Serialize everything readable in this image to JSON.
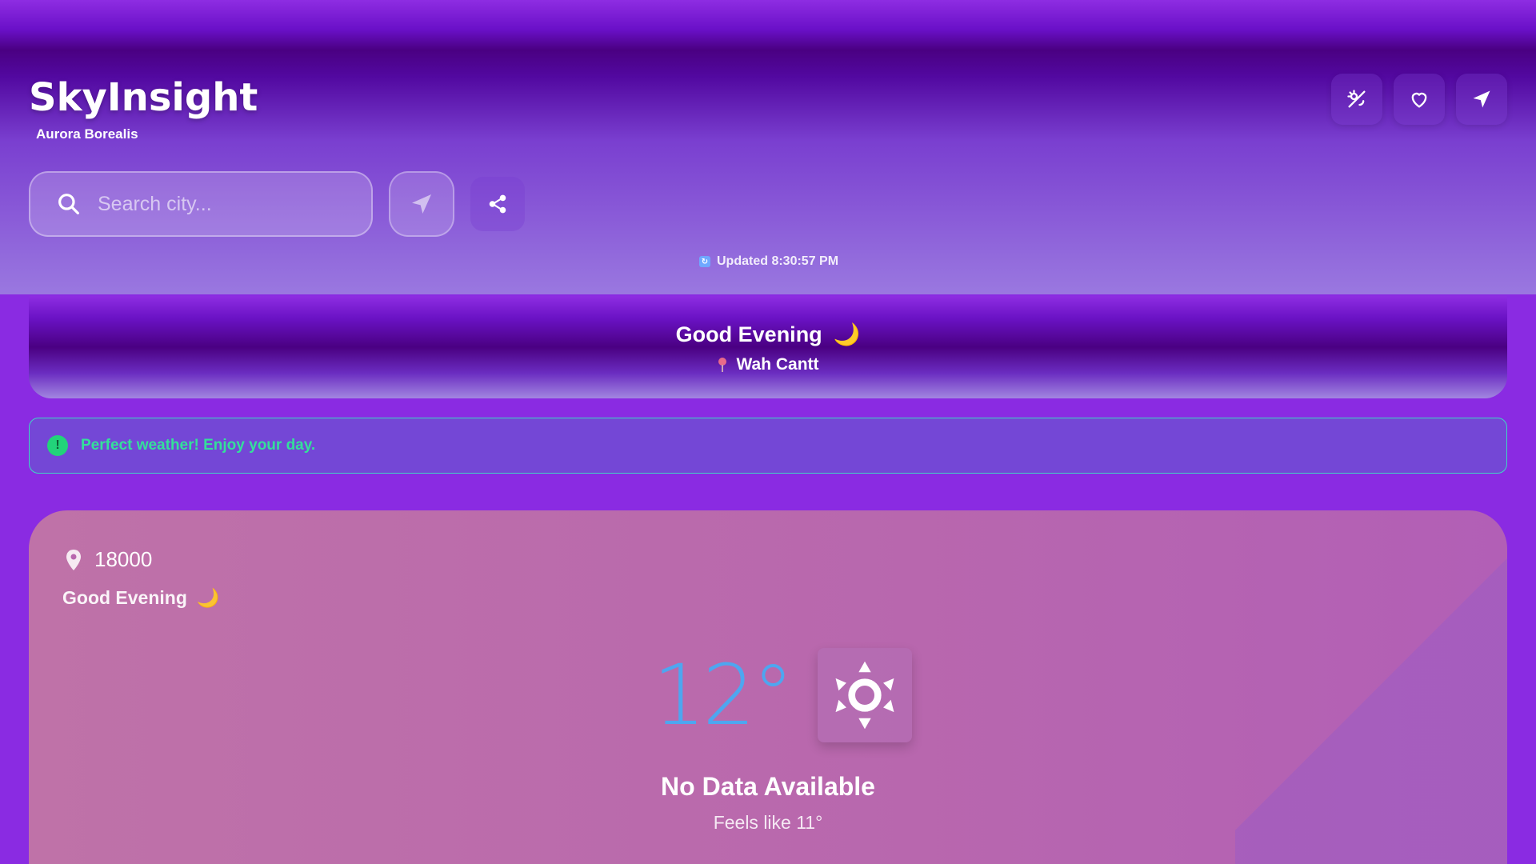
{
  "app": {
    "title": "SkyInsight",
    "subtitle": "Aurora Borealis"
  },
  "header_actions": [
    {
      "name": "theme-toggle",
      "icon": "sun-moon-icon"
    },
    {
      "name": "favorites",
      "icon": "heart-icon"
    },
    {
      "name": "navigate",
      "icon": "navigation-arrow-icon"
    }
  ],
  "search": {
    "placeholder": "Search city..."
  },
  "updated": {
    "label": "Updated 8:30:57 PM"
  },
  "greeting": {
    "text": "Good Evening",
    "emoji": "🌙",
    "location": "Wah Cantt"
  },
  "alert": {
    "text": "Perfect weather! Enjoy your day.",
    "icon": "!"
  },
  "weather": {
    "location": "18000",
    "greeting": "Good Evening",
    "emoji": "🌙",
    "temperature": "12°",
    "condition": "No Data Available",
    "feels_like": "Feels like 11°"
  },
  "colors": {
    "accent": "#8a2be2",
    "temperature": "#4ea6f0",
    "alert_text": "#34e09a",
    "alert_border": "#3fd6c4"
  }
}
